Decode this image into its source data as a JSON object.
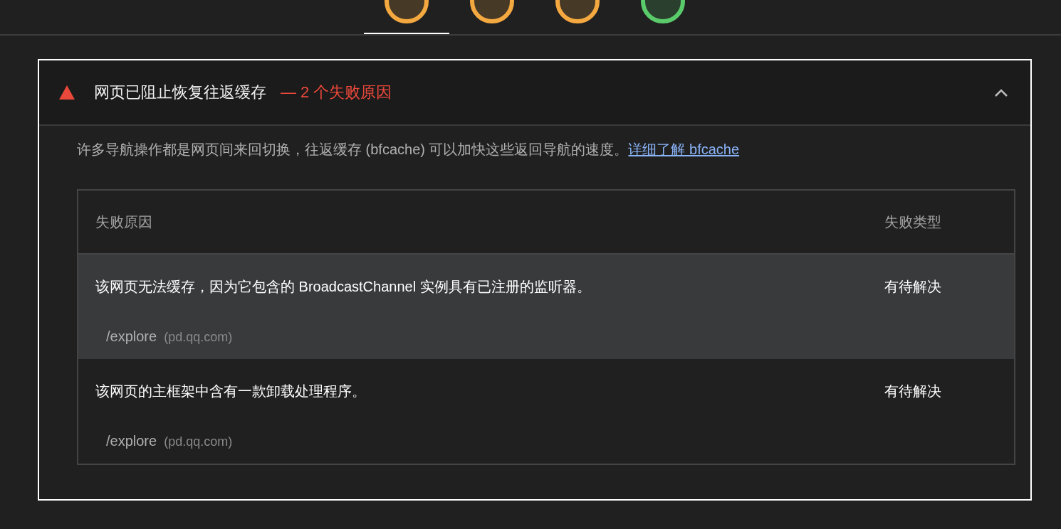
{
  "gauges": [
    {
      "color": "#f4a940",
      "selected": true
    },
    {
      "color": "#f4a940",
      "selected": false
    },
    {
      "color": "#f4a940",
      "selected": false
    },
    {
      "color": "#5acb6a",
      "selected": false
    }
  ],
  "panel": {
    "title": "网页已阻止恢复往返缓存",
    "failure_summary": "— 2 个失败原因",
    "expanded": true,
    "description": "许多导航操作都是网页间来回切换，往返缓存 (bfcache) 可以加快这些返回导航的速度。",
    "link": "详细了解 bfcache",
    "table": {
      "columns": [
        "失败原因",
        "失败类型"
      ],
      "rows": [
        {
          "reason": "该网页无法缓存，因为它包含的 BroadcastChannel 实例具有已注册的监听器。",
          "type": "有待解决",
          "path": "/explore",
          "host": "(pd.qq.com)",
          "selected": true
        },
        {
          "reason": "该网页的主框架中含有一款卸载处理程序。",
          "type": "有待解决",
          "path": "/explore",
          "host": "(pd.qq.com)",
          "selected": false
        }
      ]
    }
  }
}
